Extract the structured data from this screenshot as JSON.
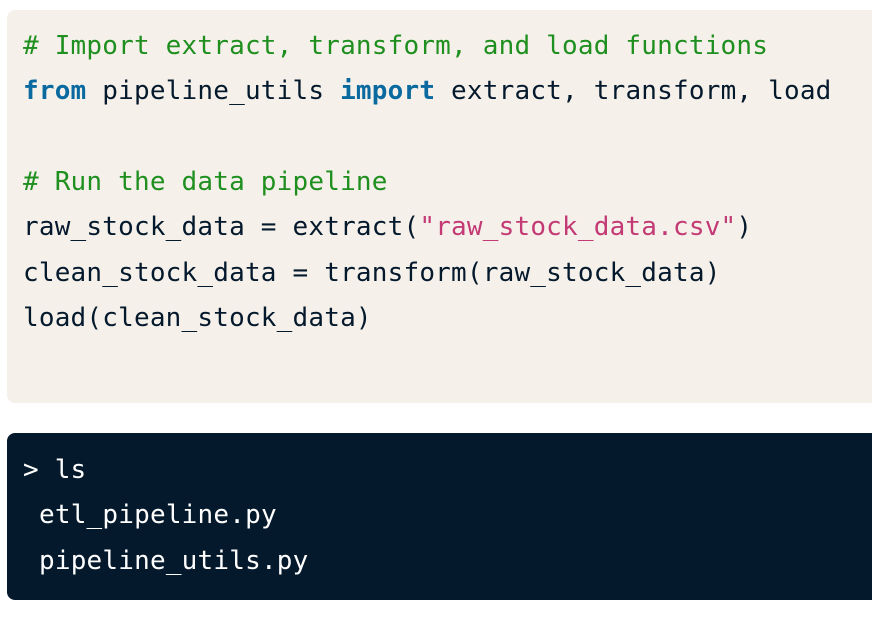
{
  "code_cell": {
    "lines": [
      {
        "comment": "# Import extract, transform, and load functions"
      },
      {
        "kw_from": "from",
        "module": " pipeline_utils ",
        "kw_import": "import",
        "names": " extract, transform, load"
      },
      {},
      {
        "comment": "# Run the data pipeline"
      },
      {
        "pre": "raw_stock_data = extract(",
        "string": "\"raw_stock_data.csv\"",
        "post": ")"
      },
      {
        "text": "clean_stock_data = transform(raw_stock_data)"
      },
      {
        "text": "load(clean_stock_data)"
      }
    ]
  },
  "terminal": {
    "command": "> ls",
    "output": [
      "etl_pipeline.py",
      "pipeline_utils.py"
    ]
  },
  "colors": {
    "code_background": "#f5f1ea",
    "terminal_background": "#05192d",
    "comment": "#1f8f1f",
    "keyword": "#0a6aa0",
    "string": "#c33a75"
  }
}
